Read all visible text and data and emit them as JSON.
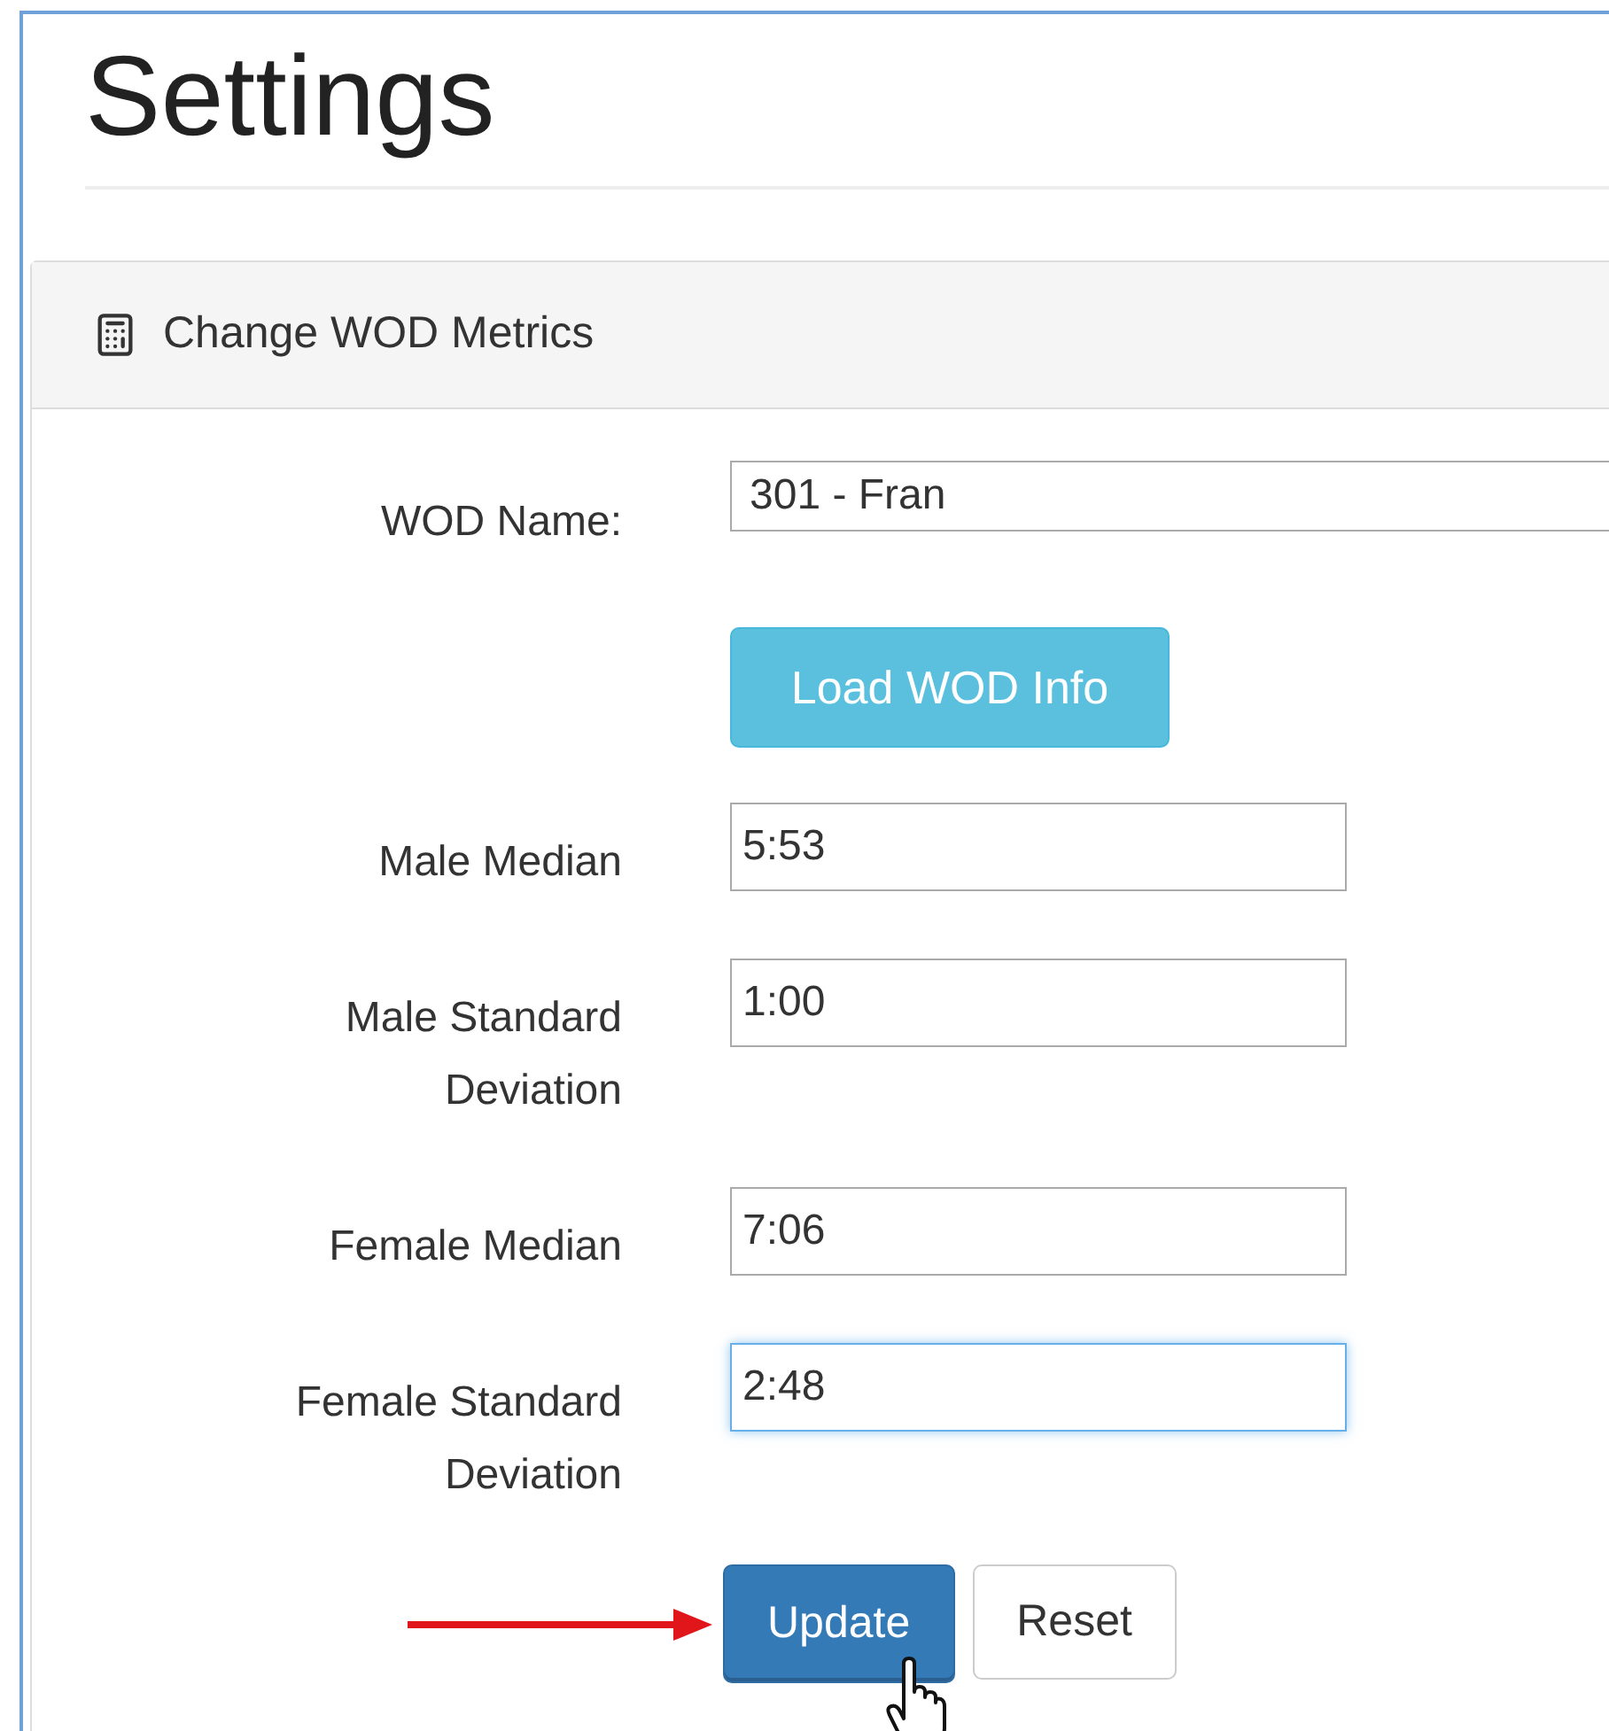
{
  "page": {
    "title": "Settings"
  },
  "panel": {
    "title": "Change WOD Metrics",
    "wod_name": {
      "label": "WOD Name:",
      "value": "301 - Fran"
    },
    "load_button": "Load WOD Info",
    "fields": [
      {
        "label": "Male Median",
        "value": "5:53",
        "focused": false
      },
      {
        "label": "Male Standard Deviation",
        "value": "1:00",
        "focused": false
      },
      {
        "label": "Female Median",
        "value": "7:06",
        "focused": false
      },
      {
        "label": "Female Standard Deviation",
        "value": "2:48",
        "focused": true
      }
    ],
    "buttons": [
      {
        "label": "Update",
        "kind": "primary",
        "hovered": true
      },
      {
        "label": "Reset",
        "kind": "default",
        "hovered": false
      }
    ]
  }
}
